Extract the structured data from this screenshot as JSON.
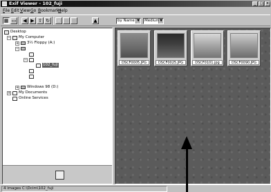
{
  "titlebar": {
    "title": "Exif Viewer - 102_fuji",
    "minimize": "_",
    "maximize": "□",
    "close": "×"
  },
  "menu": [
    "File",
    "Edit",
    "View",
    "Go",
    "Bookmarks",
    "Help"
  ],
  "toolbar": {
    "sort_combo": "by Name",
    "size_combo": "Medium",
    "icons": [
      "thumbnail-view-icon",
      "detail-view-icon",
      "back-icon",
      "forward-icon",
      "up-folder-icon",
      "refresh-icon",
      "copy-icon",
      "paste-icon",
      "delete-icon",
      "slideshow-icon"
    ]
  },
  "tree": [
    {
      "label": "Desktop",
      "indent": 0,
      "expander": "",
      "icon": "desktop"
    },
    {
      "label": "My Computer",
      "indent": 1,
      "expander": "−",
      "icon": "computer"
    },
    {
      "label": "3½ Floppy (A:)",
      "indent": 2,
      "expander": "+",
      "icon": "drive"
    },
    {
      "label": "",
      "indent": 2,
      "expander": "−",
      "icon": "drive"
    },
    {
      "label": "",
      "indent": 3,
      "expander": "",
      "icon": "folder"
    },
    {
      "label": "",
      "indent": 3,
      "expander": "−",
      "icon": "folder"
    },
    {
      "label": "102_fuji",
      "indent": 4,
      "expander": "",
      "icon": "folder",
      "selected": true
    },
    {
      "label": "",
      "indent": 3,
      "expander": "",
      "icon": "folder"
    },
    {
      "label": "",
      "indent": 3,
      "expander": "",
      "icon": "folder"
    },
    {
      "label": "Windows 98 (D:)",
      "indent": 2,
      "expander": "+",
      "icon": "drive"
    },
    {
      "label": "My Documents",
      "indent": 1,
      "expander": "+",
      "icon": "folder"
    },
    {
      "label": "Online Services",
      "indent": 1,
      "expander": "",
      "icon": "folder"
    }
  ],
  "thumbnails": [
    {
      "caption": "DSCF0005.JPG"
    },
    {
      "caption": "DSCF0025.JPG"
    },
    {
      "caption": "DSCF0101.jpg"
    },
    {
      "caption": "DSCF0090.JPG"
    }
  ],
  "status": {
    "text": "4 images   C:\\Dcim\\102_fuji"
  }
}
